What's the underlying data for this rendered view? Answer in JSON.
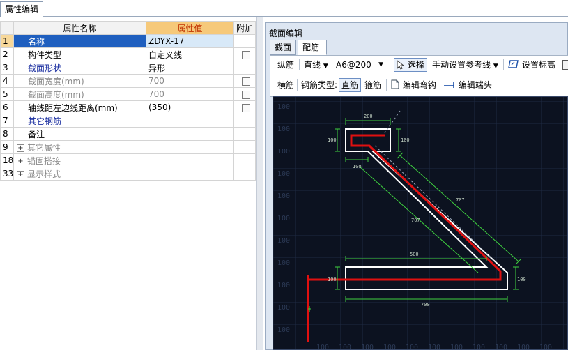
{
  "top_tab": "属性编辑",
  "grid": {
    "headers": {
      "name": "属性名称",
      "value": "属性值",
      "extra": "附加"
    },
    "rows": [
      {
        "num": "1",
        "name": "名称",
        "value": "ZDYX-17",
        "checkbox": false
      },
      {
        "num": "2",
        "name": "构件类型",
        "value": "自定义线",
        "checkbox": true
      },
      {
        "num": "3",
        "name": "截面形状",
        "value": "异形",
        "checkbox": false
      },
      {
        "num": "4",
        "name": "截面宽度(mm)",
        "value": "700",
        "checkbox": true
      },
      {
        "num": "5",
        "name": "截面高度(mm)",
        "value": "700",
        "checkbox": true
      },
      {
        "num": "6",
        "name": "轴线距左边线距离(mm)",
        "value": "(350)",
        "checkbox": true
      },
      {
        "num": "7",
        "name": "其它钢筋",
        "value": "",
        "checkbox": false
      },
      {
        "num": "8",
        "name": "备注",
        "value": "",
        "checkbox": false
      },
      {
        "num": "9",
        "name": "其它属性",
        "value": "",
        "checkbox": false
      },
      {
        "num": "18",
        "name": "锚固搭接",
        "value": "",
        "checkbox": false
      },
      {
        "num": "33",
        "name": "显示样式",
        "value": "",
        "checkbox": false
      }
    ]
  },
  "section_editor": {
    "title": "截面编辑",
    "tabs": [
      "截面",
      "配筋"
    ],
    "toolbar1": {
      "longitudinal": "纵筋",
      "line_mode": "直线",
      "rebar_spec": "A6@200",
      "select": "选择",
      "manual_ref": "手动设置参考线",
      "set_elevation": "设置标高"
    },
    "toolbar2": {
      "transverse": "横筋",
      "rebar_type_label": "钢筋类型:",
      "straight": "直筋",
      "stirrup": "箍筋",
      "edit_hook": "编辑弯钩",
      "edit_end": "编辑端头"
    },
    "canvas": {
      "grid_label": "100",
      "dims": {
        "top_width": "200",
        "left_h": "100",
        "right_h": "100",
        "bottom_small": "100",
        "diag1": "707",
        "diag2": "707",
        "bottom_top": "500",
        "bottom_left_h": "100",
        "bottom_right_h": "100",
        "bottom_width": "700"
      }
    },
    "colors": {
      "canvas_bg": "#0c1220",
      "outline": "#ffffff",
      "rebar": "#e01010",
      "dimension": "#3fd23f"
    }
  }
}
